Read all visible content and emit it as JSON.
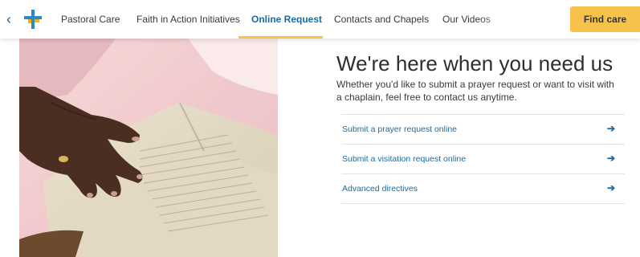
{
  "nav": {
    "items": [
      {
        "label": "Pastoral Care",
        "active": false
      },
      {
        "label": "Faith in Action Initiatives",
        "active": false
      },
      {
        "label": "Online Request",
        "active": true
      },
      {
        "label": "Contacts and Chapels",
        "active": false
      },
      {
        "label": "Our Videos",
        "active": false
      }
    ],
    "cta_label": "Find care",
    "back_icon": "chevron-left-icon",
    "logo_icon": "cross-logo"
  },
  "main": {
    "image_alt": "Hands resting on an open Bible",
    "headline": "We're here when you need us",
    "intro": "Whether you'd like to submit a prayer request or want to visit with a chaplain, feel free to contact us anytime.",
    "links": [
      {
        "label": "Submit a prayer request online"
      },
      {
        "label": "Submit a visitation request online"
      },
      {
        "label": "Advanced directives"
      }
    ],
    "link_arrow": "➔"
  },
  "colors": {
    "accent": "#f7c24c",
    "link": "#1f6aa0",
    "text": "#3a3a3a",
    "logo_blue": "#2f86c8",
    "logo_yellow": "#f4b400"
  }
}
